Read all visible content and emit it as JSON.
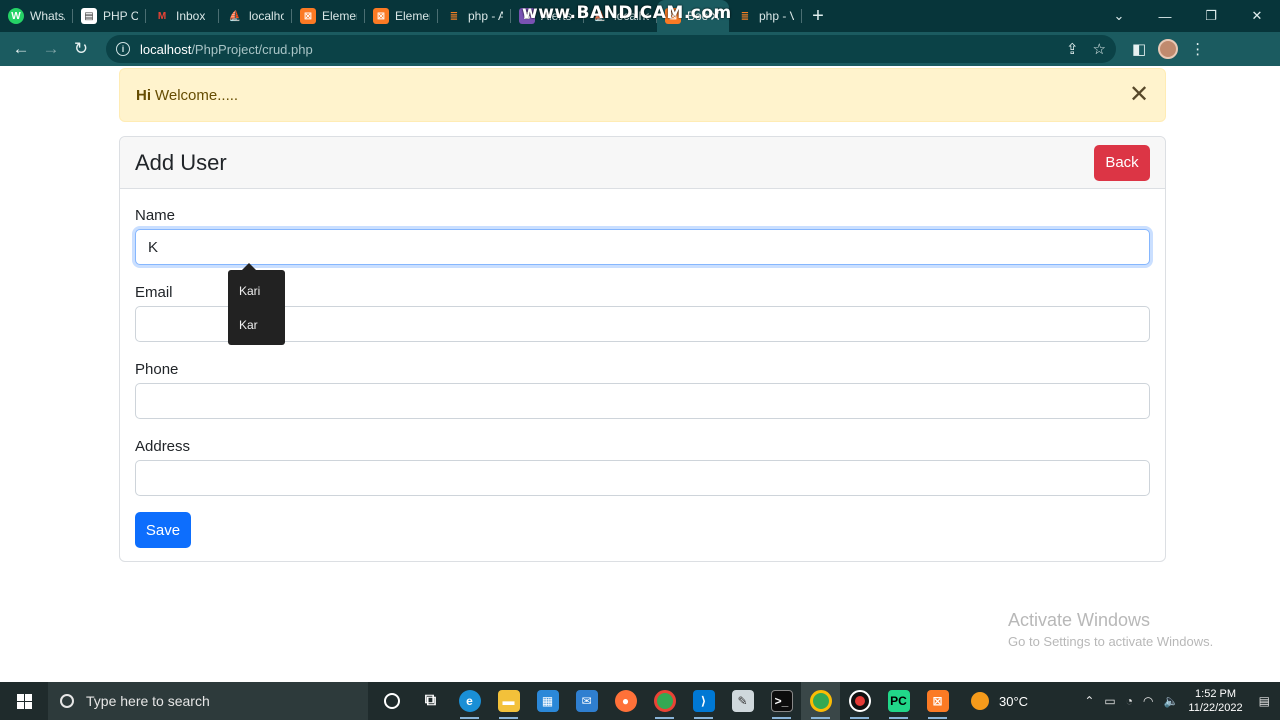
{
  "browser": {
    "tabs": [
      {
        "title": "WhatsApp",
        "icon": "whatsapp-icon",
        "icon_text": "W",
        "icon_bg": "#25d366"
      },
      {
        "title": "PHP CRUD",
        "icon": "document-icon",
        "icon_text": "▤",
        "icon_bg": "#ffffff"
      },
      {
        "title": "Inbox",
        "icon": "gmail-icon",
        "icon_text": "M",
        "icon_bg": "#ea4335"
      },
      {
        "title": "localhost",
        "icon": "phpmyadmin-icon",
        "icon_text": "⛵",
        "icon_bg": "#f0a30a"
      },
      {
        "title": "Elements",
        "icon": "xampp-icon",
        "icon_text": "⊠",
        "icon_bg": "#fb7a24"
      },
      {
        "title": "Elements",
        "icon": "xampp-icon",
        "icon_text": "⊠",
        "icon_bg": "#fb7a24"
      },
      {
        "title": "php - Ajax",
        "icon": "stackoverflow-icon",
        "icon_text": "≣",
        "icon_bg": "#f48024"
      },
      {
        "title": "Alerts",
        "icon": "bootstrap-icon",
        "icon_text": "B",
        "icon_bg": "#7952b3"
      },
      {
        "title": "localhost",
        "icon": "phpmyadmin-icon",
        "icon_text": "⛵",
        "icon_bg": "#f0a30a"
      },
      {
        "title": "Bootstrap",
        "icon": "xampp-icon",
        "icon_text": "⊠",
        "icon_bg": "#fb7a24",
        "active": true
      },
      {
        "title": "php - V",
        "icon": "stackoverflow-icon",
        "icon_text": "≣",
        "icon_bg": "#f48024"
      }
    ],
    "recorder_watermark": "www.BANDICAM.com",
    "url_host": "localhost",
    "url_path": "/PhpProject/crud.php"
  },
  "alert": {
    "strong": "Hi",
    "message": "Welcome....."
  },
  "card": {
    "title": "Add User",
    "back_label": "Back",
    "save_label": "Save",
    "fields": {
      "name": {
        "label": "Name",
        "value": "K"
      },
      "email": {
        "label": "Email",
        "value": ""
      },
      "phone": {
        "label": "Phone",
        "value": ""
      },
      "address": {
        "label": "Address",
        "value": ""
      }
    }
  },
  "autocomplete": {
    "items": [
      "Kari",
      "Kar"
    ]
  },
  "windows_watermark": {
    "title": "Activate Windows",
    "subtitle": "Go to Settings to activate Windows."
  },
  "taskbar": {
    "search_placeholder": "Type here to search",
    "weather": "30°C",
    "time": "1:52 PM",
    "date": "11/22/2022"
  },
  "colors": {
    "browser_frame": "#07353a",
    "toolbar": "#1b5b60",
    "alert_bg": "#fff3cd",
    "back_button": "#dc3545",
    "save_button": "#0d6efd"
  }
}
